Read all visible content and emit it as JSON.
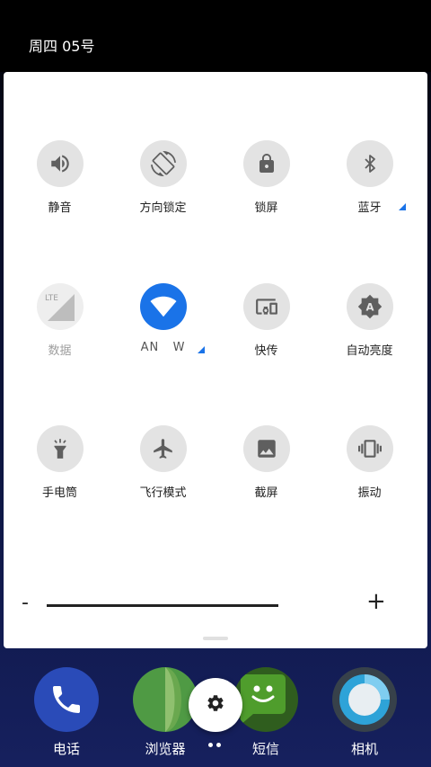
{
  "status_bar": {
    "date": "周四 05号"
  },
  "quick_settings": {
    "tiles": [
      {
        "label": "静音",
        "icon": "volume-icon"
      },
      {
        "label": "方向锁定",
        "icon": "rotation-icon"
      },
      {
        "label": "锁屏",
        "icon": "lock-icon"
      },
      {
        "label": "蓝牙",
        "icon": "bluetooth-icon"
      },
      {
        "label": "数据",
        "icon": "lte-signal-icon",
        "badge": "LTE"
      },
      {
        "label": "AN   W",
        "icon": "wifi-icon"
      },
      {
        "label": "快传",
        "icon": "devices-icon"
      },
      {
        "label": "自动亮度",
        "icon": "auto-brightness-icon",
        "badge": "A"
      },
      {
        "label": "手电筒",
        "icon": "flashlight-icon"
      },
      {
        "label": "飞行模式",
        "icon": "airplane-icon"
      },
      {
        "label": "截屏",
        "icon": "screenshot-icon"
      },
      {
        "label": "振动",
        "icon": "vibrate-icon"
      }
    ],
    "brightness": {
      "minus": "-",
      "plus": "+"
    }
  },
  "dock": {
    "apps": [
      {
        "label": "电话",
        "icon": "phone-icon"
      },
      {
        "label": "浏览器",
        "icon": "browser-icon"
      },
      {
        "label": "短信",
        "icon": "messages-icon"
      },
      {
        "label": "相机",
        "icon": "camera-icon"
      }
    ],
    "fab_icon": "settings-icon"
  },
  "colors": {
    "accent": "#1a73e8",
    "tile_bg": "#e3e3e3",
    "panel_bg": "#ffffff",
    "phone": "#2a4bb8",
    "browser": "#4f9a44",
    "messages": "#4f9d2c",
    "camera": "#2ea3d8"
  }
}
